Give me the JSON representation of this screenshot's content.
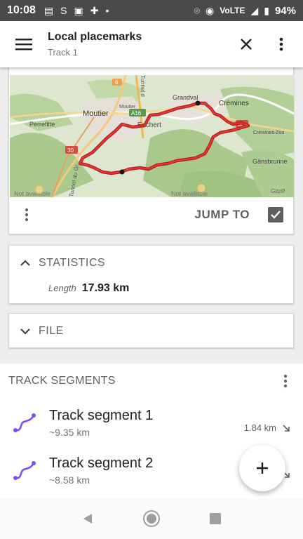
{
  "status_bar": {
    "time": "10:08",
    "network": "VoLTE",
    "battery": "94%"
  },
  "toolbar": {
    "title": "Local placemarks",
    "subtitle": "Track 1"
  },
  "map_card": {
    "labels": {
      "grandval": "Grandval",
      "cremines": "Crémines",
      "moutier": "Moutier",
      "moutier_small": "Moutier",
      "perrefitte": "Perrefitte",
      "eschert": "Eschert",
      "cremines_zoo": "Crémines-Zoo",
      "gansbrunnen": "Gänsbrunne",
      "tunnel1": "Tunnel d",
      "tunnel2": "Tunnel du Gr",
      "road_a16": "A16",
      "road_30": "30",
      "road_30b": "30",
      "road_6": "6",
      "not_available_left": "Not available",
      "not_available_mid": "Not available",
      "attribution": "Gitzifl"
    },
    "jump_label": "JUMP TO",
    "show_on_map_checked": true,
    "colors": {
      "track": "#d50000",
      "accent": "#7c4dff"
    }
  },
  "statistics": {
    "header": "STATISTICS",
    "length_label": "Length",
    "length_value": "17.93 km"
  },
  "file_section": {
    "header": "FILE"
  },
  "track_segments": {
    "header": "TRACK SEGMENTS",
    "items": [
      {
        "name": "Track segment 1",
        "length": "~9.35 km",
        "elevation": "1.84 km"
      },
      {
        "name": "Track segment 2",
        "length": "~8.58 km",
        "elevation": ""
      }
    ]
  }
}
